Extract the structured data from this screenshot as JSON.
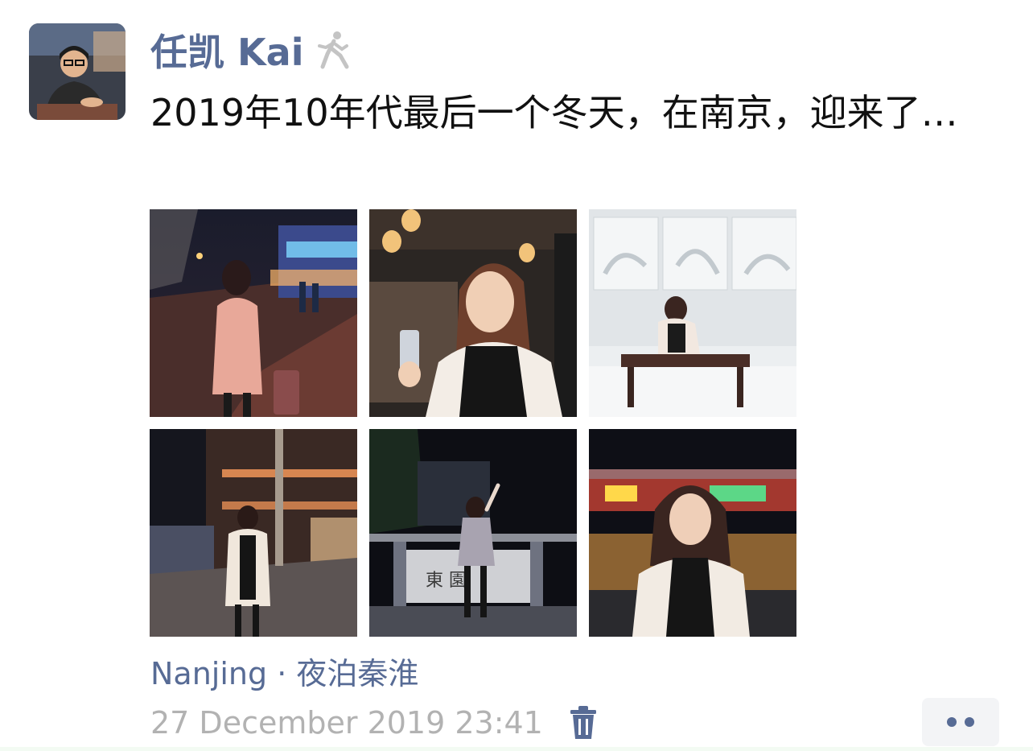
{
  "post": {
    "author": "任凯 Kai",
    "text": "2019年10年代最后一个冬天，在南京，迎来了…",
    "location": "Nanjing · 夜泊秦淮",
    "timestamp": "27 December 2019 23:41",
    "photos": [
      {
        "subject": "woman-walking-street-night"
      },
      {
        "subject": "woman-selfie-restaurant"
      },
      {
        "subject": "woman-sitting-white-relief-wall"
      },
      {
        "subject": "woman-standing-lit-street"
      },
      {
        "subject": "woman-at-riverside-railing"
      },
      {
        "subject": "woman-portrait-neon-lights"
      }
    ]
  },
  "icons": {
    "avatar": "user-avatar",
    "walker": "walking-person-icon",
    "delete": "trash-icon",
    "more": "more-dots-icon"
  },
  "colors": {
    "link": "#576b95",
    "text": "#111111",
    "muted": "#b2b2b2",
    "more_bg": "#f3f4f6"
  }
}
